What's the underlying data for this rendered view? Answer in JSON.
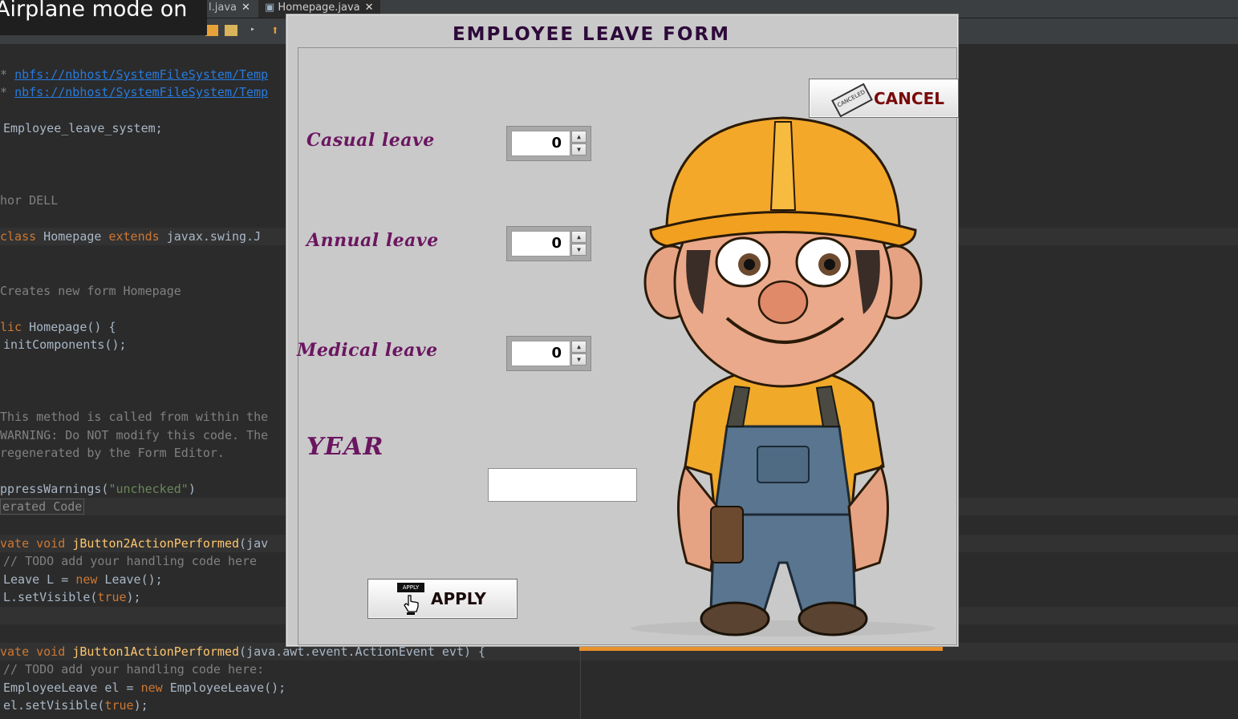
{
  "ide": {
    "tabs": [
      {
        "label": "l.java"
      },
      {
        "label": "Homepage.java"
      }
    ],
    "notification": "Airplane mode on",
    "code_lines": {
      "l1_link": "nbfs://nbhost/SystemFileSystem/Temp",
      "l2_link": "nbfs://nbhost/SystemFileSystem/Temp",
      "package": "Employee_leave_system;",
      "author": "hor DELL",
      "class_kw": "class",
      "class_name": " Homepage ",
      "extends_kw": "extends",
      "class_rest": " javax.swing.J",
      "creates": "Creates new form Homepage",
      "ctor_kw": "lic",
      "ctor_name": " Homepage() {",
      "init": "initComponents();",
      "cm1": "This method is called from within the",
      "cm2": "WARNING: Do NOT modify this code. The",
      "cm3": "regenerated by the Form Editor.",
      "suppress": "ppressWarnings(",
      "suppress_str": "\"unchecked\"",
      "suppress_end": ")",
      "generated": "erated Code",
      "m1_kw": "vate void",
      "m1_name": "jButton2ActionPerformed",
      "m1_rest": "(jav",
      "todo1": "// TODO add your handling code here",
      "leave_decl1": "Leave L = ",
      "new_kw1": "new",
      "leave_decl2": " Leave();",
      "setvis1a": "L.setVisible(",
      "true1": "true",
      "setvis1b": ");",
      "m2_kw": "vate void",
      "m2_name": "jButton1ActionPerformed",
      "m2_rest": "(java.awt.event.ActionEvent evt) {",
      "todo2": "// TODO add your handling code here:",
      "el_decl1": "EmployeeLeave el = ",
      "new_kw2": "new",
      "el_decl2": " EmployeeLeave();",
      "setvis2a": "el.setVisible(",
      "true2": "true",
      "setvis2b": ");"
    }
  },
  "form": {
    "title": "EMPLOYEE LEAVE FORM",
    "cancel_label": "CANCEL",
    "cancel_icon_text": "CANCELED",
    "apply_label": "APPLY",
    "apply_icon_text": "APPLY",
    "fields": {
      "casual_label": "Casual leave",
      "casual_value": "0",
      "annual_label": "Annual leave",
      "annual_value": "0",
      "medical_label": "Medical leave",
      "medical_value": "0",
      "year_label": "YEAR",
      "year_value": ""
    }
  },
  "colors": {
    "label": "#6b1560",
    "title": "#2e0a3a",
    "cancel_text": "#7a0a0a",
    "dialog_bg": "#c9c9c9"
  },
  "icons": [
    "close-icon",
    "cancel-stamp-icon",
    "apply-hand-icon",
    "spinner-up-icon",
    "spinner-down-icon",
    "worker-illustration"
  ]
}
